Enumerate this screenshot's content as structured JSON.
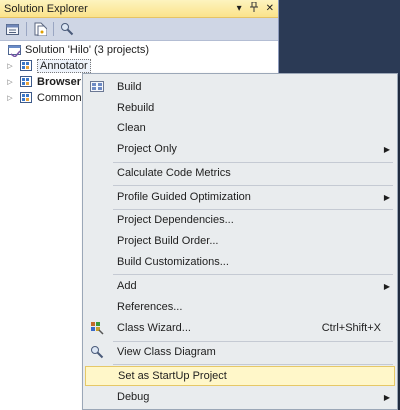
{
  "panel": {
    "title": "Solution Explorer",
    "pin_glyph": "▾",
    "dock_glyph": "ꟾ",
    "close_glyph": "✕"
  },
  "tree": {
    "solution": "Solution 'Hilo' (3 projects)",
    "projects": [
      {
        "label": "Annotator",
        "bold": false,
        "selected": true
      },
      {
        "label": "Browser",
        "bold": true,
        "selected": false
      },
      {
        "label": "Common",
        "bold": false,
        "selected": false
      }
    ]
  },
  "menu": {
    "items": {
      "build": "Build",
      "rebuild": "Rebuild",
      "clean": "Clean",
      "project_only": "Project Only",
      "calc_metrics": "Calculate Code Metrics",
      "pgo": "Profile Guided Optimization",
      "dependencies": "Project Dependencies...",
      "build_order": "Project Build Order...",
      "build_custom": "Build Customizations...",
      "add": "Add",
      "references": "References...",
      "class_wizard": "Class Wizard...",
      "class_wizard_shortcut": "Ctrl+Shift+X",
      "view_class_diagram": "View Class Diagram",
      "startup": "Set as StartUp Project",
      "debug": "Debug"
    },
    "submenu_arrow": "▶"
  }
}
